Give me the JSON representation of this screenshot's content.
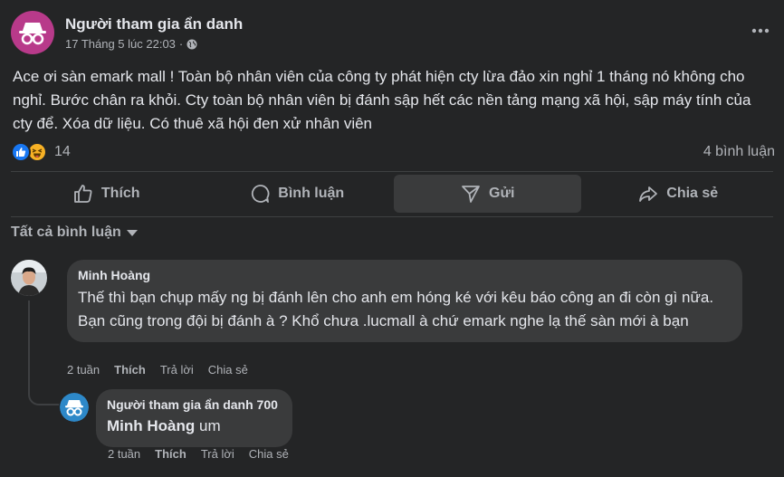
{
  "post": {
    "author": "Người tham gia ẩn danh",
    "timestamp": "17 Tháng 5 lúc 22:03",
    "separator": "·",
    "privacy_icon": "globe-icon",
    "more_icon": "more-icon",
    "text": "Ace ơi sàn emark mall ! Toàn bộ nhân viên của công ty phát hiện cty lừa đảo xin nghỉ 1 tháng nó không cho nghỉ. Bước chân ra khỏi. Cty toàn bộ nhân viên bị đánh sập hết các nền tảng mạng xã hội, sập máy tính của cty để. Xóa dữ liệu. Có thuê xã hội đen xử nhân viên",
    "reaction_count": "14",
    "comment_count": "4 bình luận",
    "avatar_color": "#b83a8a"
  },
  "actions": {
    "like": "Thích",
    "comment": "Bình luận",
    "send": "Gửi",
    "share": "Chia sẻ"
  },
  "filter": {
    "label": "Tất cả bình luận"
  },
  "comments": [
    {
      "author": "Minh Hoàng",
      "text": "Thế thì bạn chụp mấy ng bị đánh lên cho anh em hóng ké với kêu báo công an đi còn gì nữa. Bạn cũng trong đội bị đánh à ? Khổ chưa .lucmall à chứ emark nghe lạ thế sàn mới à bạn",
      "time": "2 tuần",
      "like": "Thích",
      "reply": "Trả lời",
      "share": "Chia sẻ"
    },
    {
      "author": "Người tham gia ẩn danh 700",
      "mention": "Minh Hoàng",
      "text": " um",
      "time": "2 tuần",
      "like": "Thích",
      "reply": "Trả lời",
      "share": "Chia sẻ",
      "avatar_color": "#2d88c8"
    }
  ],
  "colors": {
    "background": "#242526",
    "bubble": "#3a3b3c",
    "text_primary": "#e4e6eb",
    "text_secondary": "#b0b3b8",
    "like_blue": "#1877f2"
  }
}
